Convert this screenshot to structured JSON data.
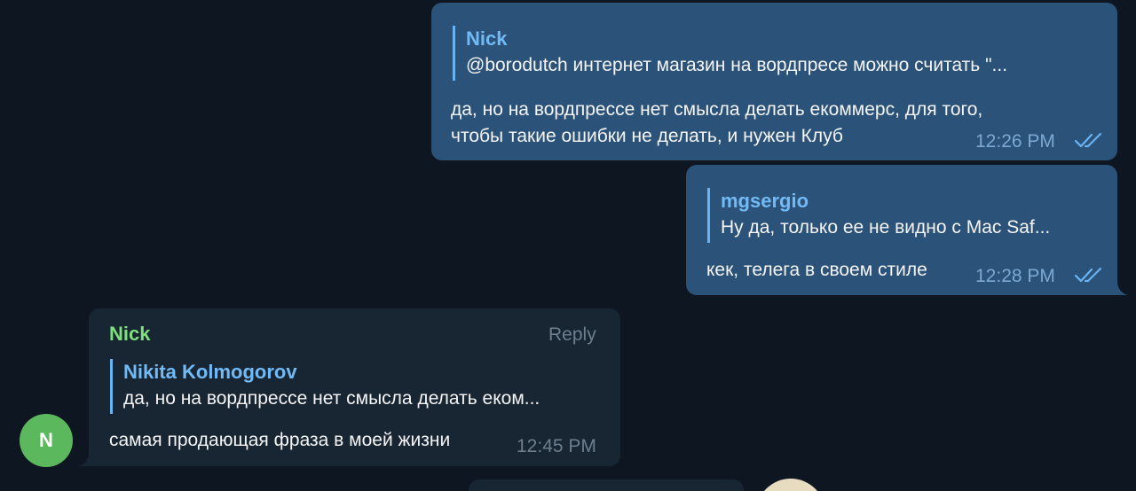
{
  "messages": [
    {
      "quote_name": "Nick",
      "quote_text": "@borodutch интернет магазин на вордпресе можно считать \"...",
      "text_lines": [
        "да, но на вордпрессе нет смысла делать екоммерс, для того,",
        "чтобы такие ошибки не делать, и нужен Клуб"
      ],
      "time": "12:26 PM"
    },
    {
      "quote_name": "mgsergio",
      "quote_text": "Ну да, только ее не видно с Mac Saf...",
      "text_lines": [
        "кек, телега в своем стиле"
      ],
      "time": "12:28 PM"
    },
    {
      "sender": "Nick",
      "reply_label": "Reply",
      "quote_name": "Nikita Kolmogorov",
      "quote_text": "да, но на вордпрессе нет смысла делать еком...",
      "text_lines": [
        "самая продающая фраза в моей жизни"
      ],
      "time": "12:45 PM",
      "avatar_letter": "N"
    }
  ],
  "colors": {
    "background": "#0e1621",
    "outgoing_bubble": "#2b5278",
    "incoming_bubble": "#182533",
    "quote_accent": "#6ab3f3",
    "sender_name": "#7ee07e",
    "avatar": "#5cb85c",
    "read_check": "#6ab3f3"
  },
  "icons": {
    "read_status": "double-check-icon"
  }
}
